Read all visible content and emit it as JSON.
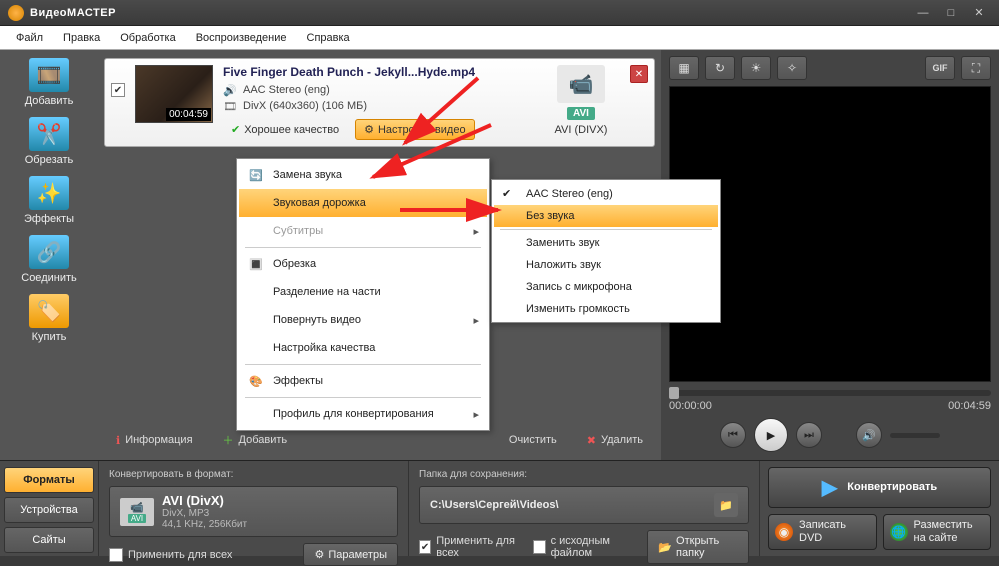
{
  "app": {
    "title": "ВидеоМАСТЕР"
  },
  "menu": {
    "items": [
      "Файл",
      "Правка",
      "Обработка",
      "Воспроизведение",
      "Справка"
    ]
  },
  "sidebar": {
    "add": "Добавить",
    "cut": "Обрезать",
    "effects": "Эффекты",
    "join": "Соединить",
    "buy": "Купить"
  },
  "file": {
    "title": "Five Finger Death Punch - Jekyll...Hyde.mp4",
    "audio": "AAC Stereo (eng)",
    "video": "DivX (640x360) (106 МБ)",
    "duration": "00:04:59",
    "quality_label": "Хорошее качество",
    "settings_label": "Настройки видео",
    "out_format_badge": "AVI",
    "out_format_name": "AVI (DIVX)"
  },
  "toolbar": {
    "info": "Информация",
    "add": "Добавить",
    "clear": "Очистить",
    "delete": "Удалить"
  },
  "ctx": {
    "replace_audio": "Замена звука",
    "audio_track": "Звуковая дорожка",
    "subtitles": "Субтитры",
    "crop": "Обрезка",
    "split": "Разделение на части",
    "rotate": "Повернуть видео",
    "quality": "Настройка качества",
    "effects": "Эффекты",
    "profile": "Профиль для конвертирования"
  },
  "sub": {
    "track": "AAC Stereo (eng)",
    "no_audio": "Без звука",
    "replace": "Заменить звук",
    "overlay": "Наложить звук",
    "mic": "Запись с микрофона",
    "volume": "Изменить громкость"
  },
  "preview": {
    "time_start": "00:00:00",
    "time_end": "00:04:59"
  },
  "tabs": {
    "formats": "Форматы",
    "devices": "Устройства",
    "sites": "Сайты"
  },
  "format_panel": {
    "header": "Конвертировать в формат:",
    "badge": "AVI",
    "name": "AVI (DivX)",
    "details": "DivX, MP3\n44,1 KHz, 256Кбит",
    "apply_all": "Применить для всех",
    "params": "Параметры"
  },
  "folder_panel": {
    "header": "Папка для сохранения:",
    "path": "C:\\Users\\Сергей\\Videos\\",
    "apply_all": "Применить для всех",
    "keep_src": "с исходным файлом",
    "open": "Открыть папку"
  },
  "actions": {
    "convert": "Конвертировать",
    "dvd": "Записать\nDVD",
    "publish": "Разместить\nна сайте"
  },
  "colors": {
    "accent": "#ffb030"
  }
}
